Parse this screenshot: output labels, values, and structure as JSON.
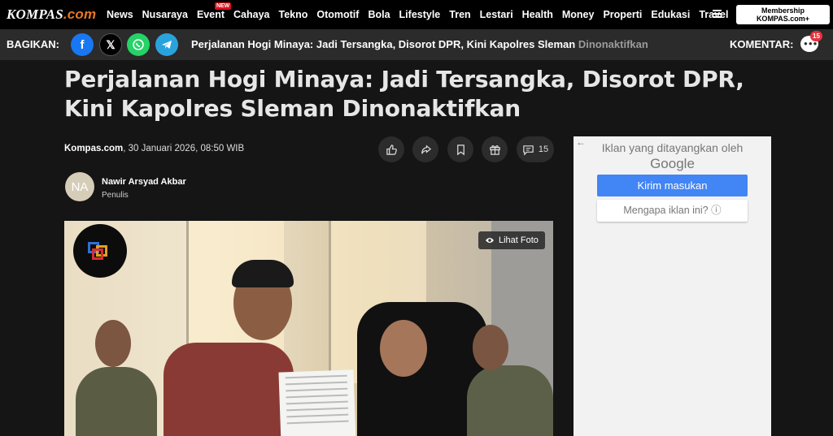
{
  "topnav": {
    "logo_main": "KOMPAS",
    "logo_suffix": ".com",
    "links": [
      "News",
      "Nusaraya",
      "Event",
      "Cahaya",
      "Tekno",
      "Otomotif",
      "Bola",
      "Lifestyle",
      "Tren",
      "Lestari",
      "Health",
      "Money",
      "Properti",
      "Edukasi",
      "Travel"
    ],
    "new_badge": "NEW",
    "membership_line1": "Membership",
    "membership_line2": "KOMPAS.com+"
  },
  "sharebar": {
    "label": "BAGIKAN:",
    "icons": [
      "facebook-icon",
      "x-icon",
      "whatsapp-icon",
      "telegram-icon"
    ],
    "title_main": "Perjalanan Hogi Minaya: Jadi Tersangka, Disorot DPR, Kini Kapolres Sleman ",
    "title_faded": "Dinonaktifkan",
    "komentar_label": "KOMENTAR:",
    "komentar_count": "15"
  },
  "article": {
    "headline": "Perjalanan Hogi Minaya: Jadi Tersangka, Disorot DPR, Kini Kapolres Sleman Dinonaktifkan",
    "source": "Kompas.com",
    "date": ", 30 Januari 2026, 08:50 WIB",
    "comment_count": "15",
    "author_initials": "NA",
    "author_name": "Nawir Arsyad Akbar",
    "author_role": "Penulis",
    "photo_button": "Lihat Foto"
  },
  "ad": {
    "back_arrow": "←",
    "line1": "Iklan yang ditayangkan oleh",
    "line2": "Google",
    "button_feedback": "Kirim masukan",
    "button_why": "Mengapa iklan ini?",
    "info_icon": "ⓘ"
  },
  "colors": {
    "accent_orange": "#e87722",
    "background": "#151515",
    "sharebar": "#2b2b2b",
    "facebook": "#1877f2",
    "whatsapp": "#25d366",
    "telegram": "#2aa3dc",
    "ad_button": "#4285f4",
    "badge_red": "#e4323c"
  }
}
